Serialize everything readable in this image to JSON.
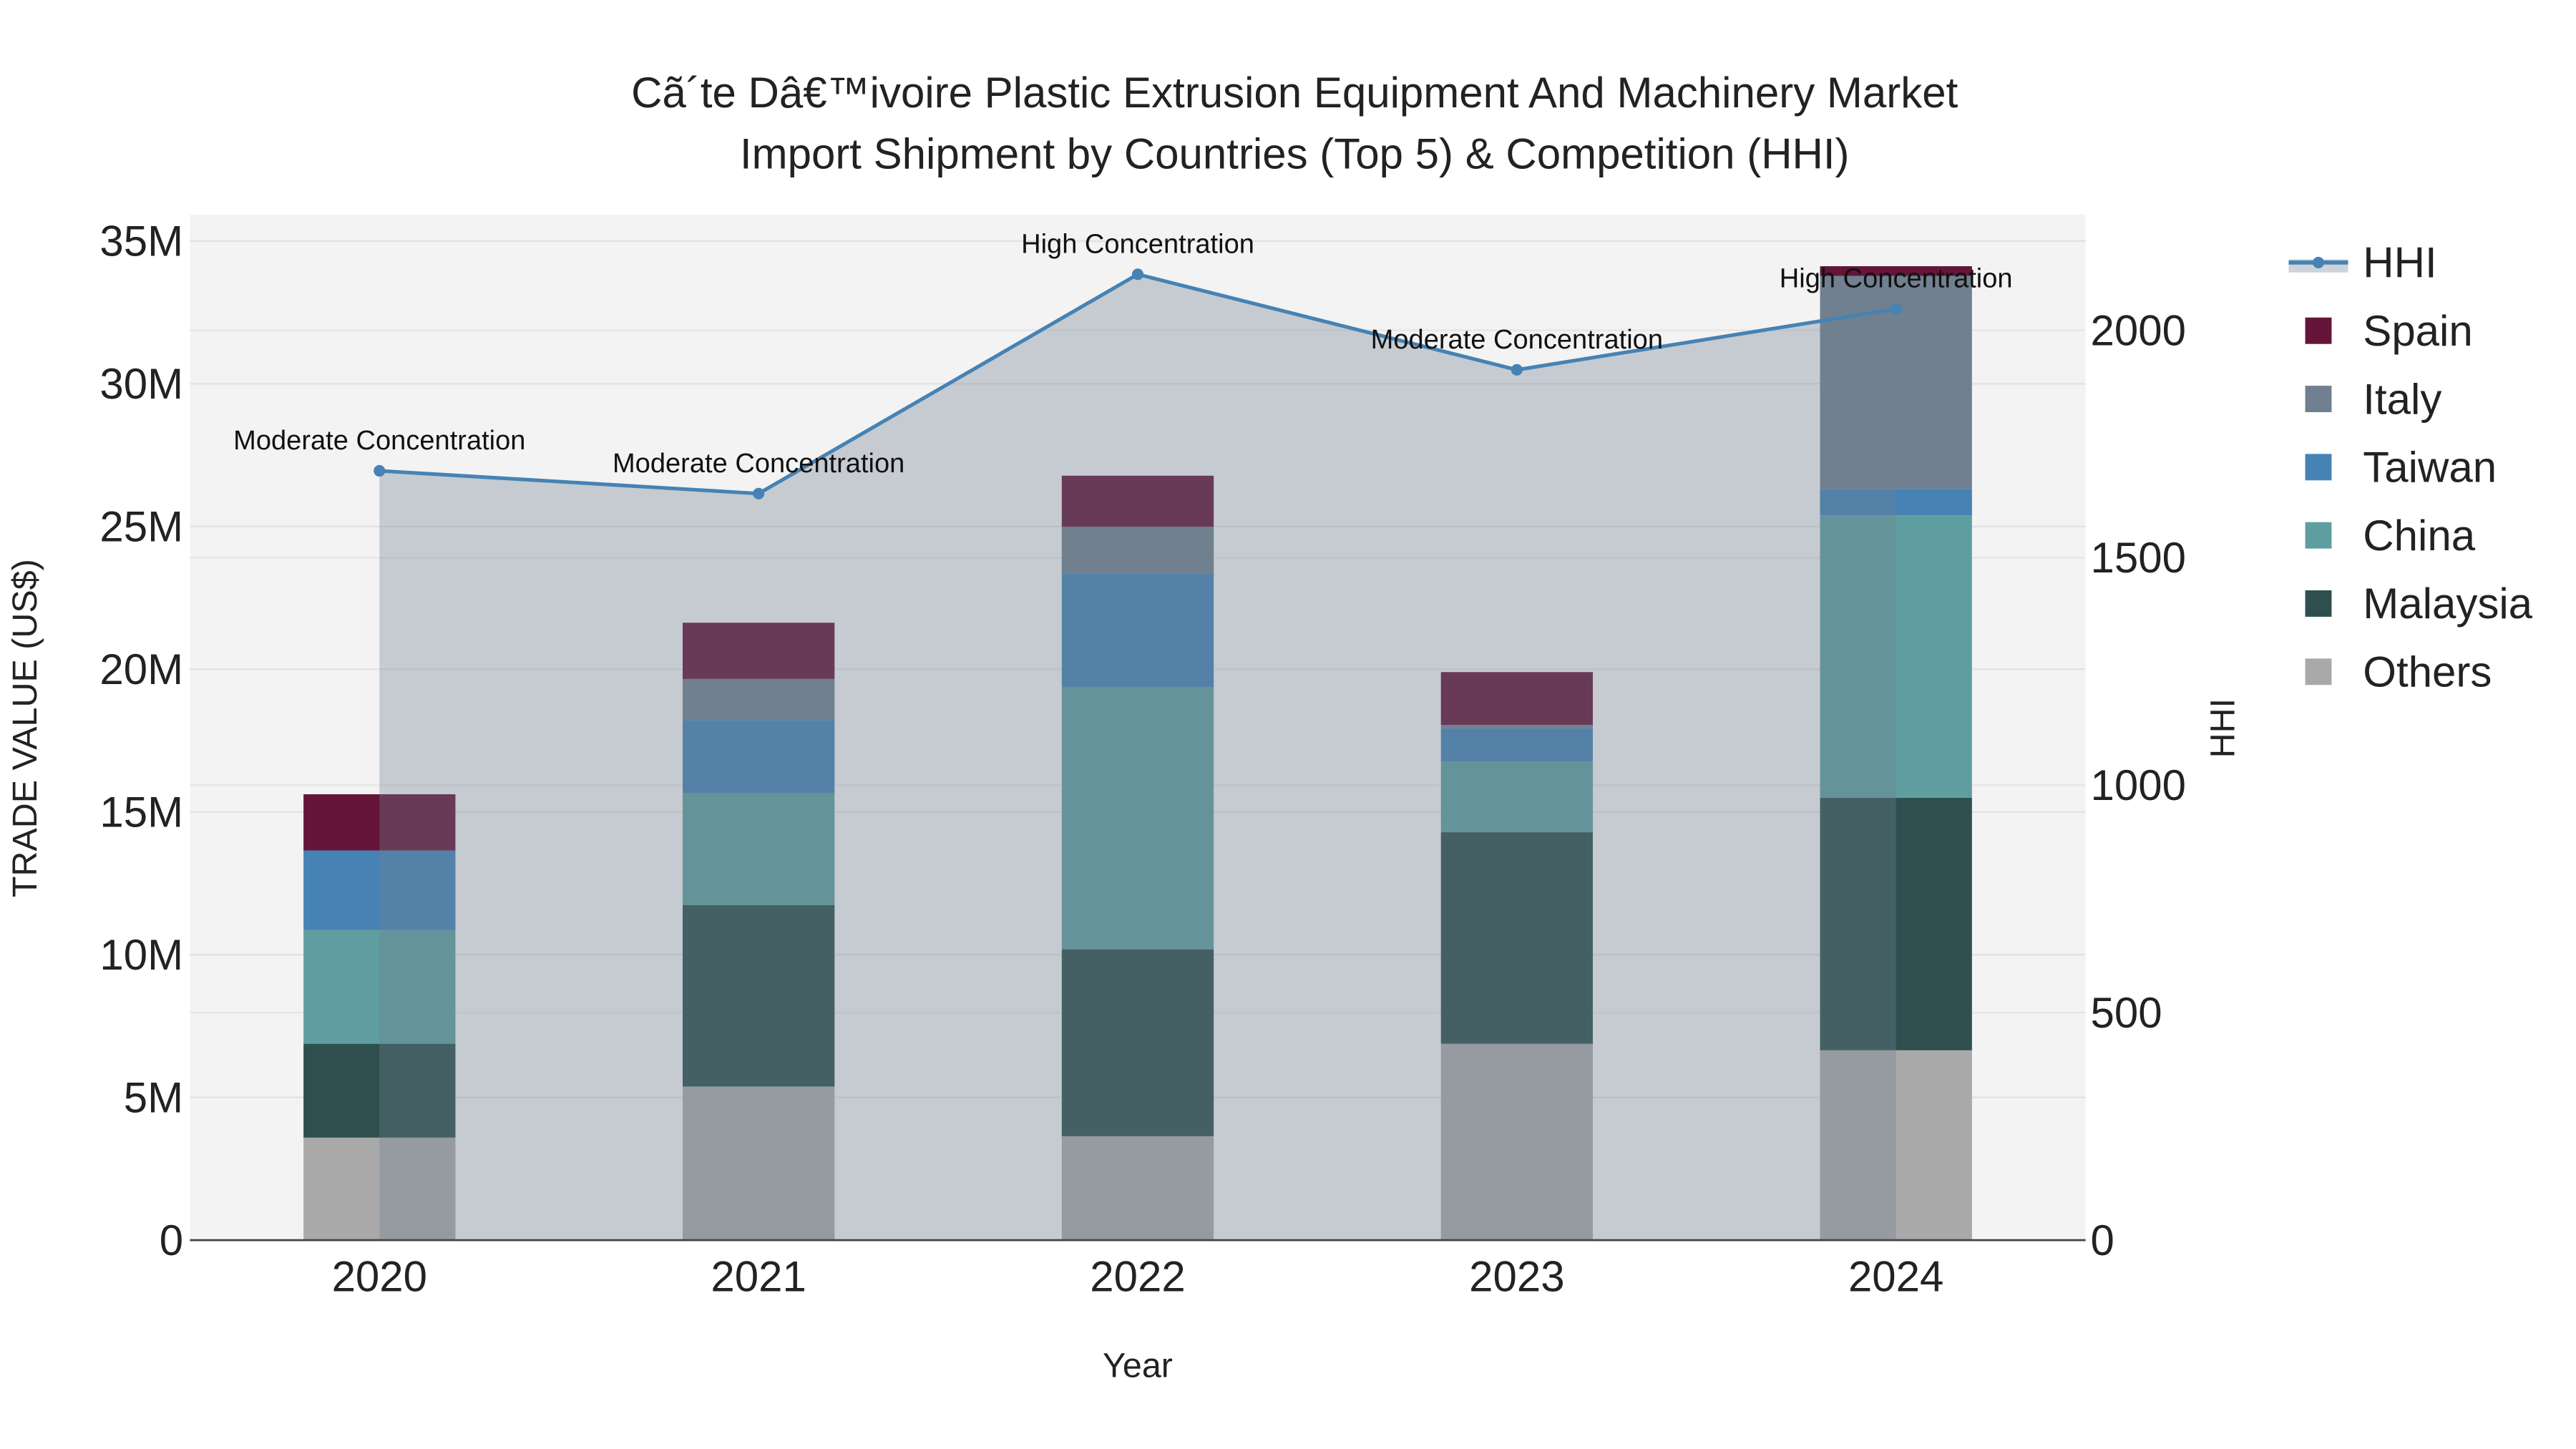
{
  "chart_data": {
    "type": "bar",
    "title_line1": "Cã´te Dâ€™ivoire Plastic Extrusion Equipment And Machinery Market",
    "title_line2": "Import Shipment by Countries (Top 5) & Competition (HHI)",
    "xlabel": "Year",
    "ylabel": "TRADE VALUE (US$)",
    "y2label": "HHI",
    "categories": [
      "2020",
      "2021",
      "2022",
      "2023",
      "2024"
    ],
    "ylim": [
      0,
      35000000
    ],
    "y2lim": [
      0,
      2200
    ],
    "yticks": [
      {
        "v": 0,
        "l": "0"
      },
      {
        "v": 5000000,
        "l": "5M"
      },
      {
        "v": 10000000,
        "l": "10M"
      },
      {
        "v": 15000000,
        "l": "15M"
      },
      {
        "v": 20000000,
        "l": "20M"
      },
      {
        "v": 25000000,
        "l": "25M"
      },
      {
        "v": 30000000,
        "l": "30M"
      },
      {
        "v": 35000000,
        "l": "35M"
      }
    ],
    "y2ticks": [
      {
        "v": 0,
        "l": "0"
      },
      {
        "v": 500,
        "l": "500"
      },
      {
        "v": 1000,
        "l": "1000"
      },
      {
        "v": 1500,
        "l": "1500"
      },
      {
        "v": 2000,
        "l": "2000"
      }
    ],
    "series": [
      {
        "name": "Others",
        "color": "#a9a9a9",
        "values": [
          3590000,
          5380000,
          3640000,
          6880000,
          6650000
        ]
      },
      {
        "name": "Malaysia",
        "color": "#2f4f4f",
        "values": [
          3290000,
          6360000,
          6540000,
          7410000,
          8850000
        ]
      },
      {
        "name": "China",
        "color": "#5f9ea0",
        "values": [
          3990000,
          3930000,
          9200000,
          2480000,
          9890000
        ]
      },
      {
        "name": "Taiwan",
        "color": "#4682b4",
        "values": [
          2780000,
          2550000,
          3990000,
          1160000,
          930000
        ]
      },
      {
        "name": "Italy",
        "color": "#708090",
        "values": [
          0,
          1440000,
          1620000,
          120000,
          7460000
        ]
      },
      {
        "name": "Spain",
        "color": "#641539",
        "values": [
          1970000,
          1970000,
          1790000,
          1850000,
          340000
        ]
      }
    ],
    "hhi": {
      "name": "HHI",
      "color": "#4682b4",
      "values": [
        1691,
        1641,
        2123,
        1913,
        2047
      ],
      "annotations": [
        "Moderate Concentration",
        "Moderate Concentration",
        "High Concentration",
        "Moderate Concentration",
        "High Concentration"
      ]
    },
    "legend_order": [
      "HHI",
      "Spain",
      "Italy",
      "Taiwan",
      "China",
      "Malaysia",
      "Others"
    ],
    "legend_placement": "right",
    "grid": true
  }
}
